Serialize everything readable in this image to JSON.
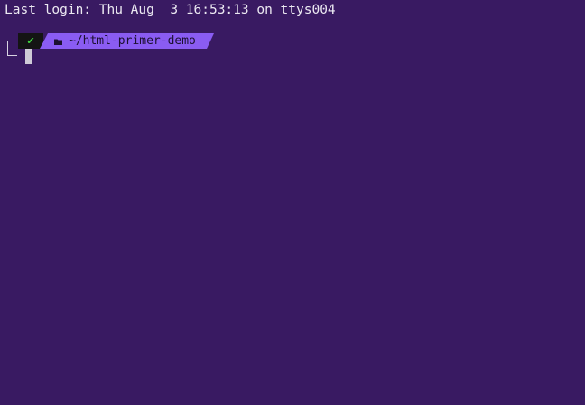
{
  "terminal": {
    "last_login": "Last login: Thu Aug  3 16:53:13 on ttys004",
    "prompt": {
      "status_icon": "check-icon",
      "status_glyph": "✔",
      "folder_icon": "folder-icon",
      "path": "~/html-primer-demo"
    }
  },
  "colors": {
    "background": "#391a62",
    "status_bg": "#141414",
    "status_ok": "#3fd23f",
    "path_bg": "#8a5cf2",
    "cursor": "#cfcbd7"
  }
}
